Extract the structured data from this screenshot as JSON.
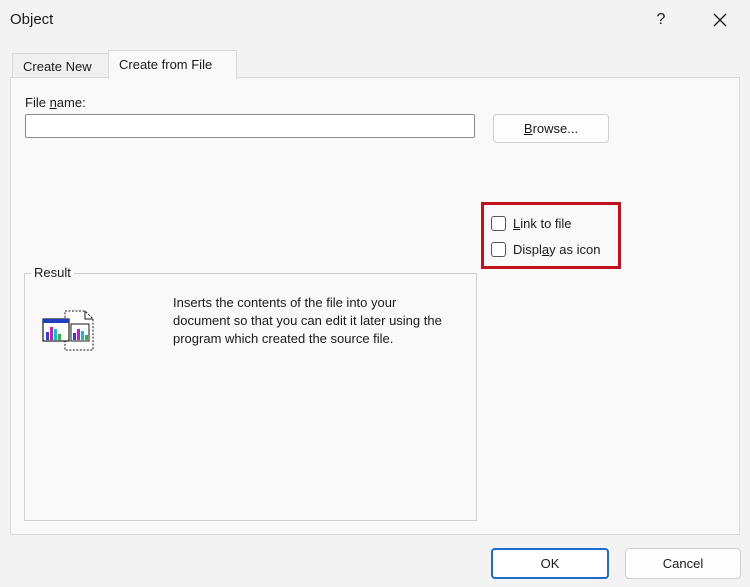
{
  "window": {
    "title": "Object",
    "help_label": "?"
  },
  "tabs": [
    {
      "label": "Create New",
      "active": false
    },
    {
      "label": "Create from File",
      "active": true
    }
  ],
  "file_name": {
    "label_pre": "File ",
    "label_mnemonic": "n",
    "label_post": "ame:",
    "value": "",
    "placeholder": ""
  },
  "browse": {
    "mnemonic": "B",
    "rest": "rowse..."
  },
  "options": {
    "link": {
      "mnemonic": "L",
      "rest": "ink to file",
      "checked": false
    },
    "icon": {
      "pre": "Displ",
      "mnemonic": "a",
      "post": "y as icon",
      "checked": false
    },
    "highlight_color": "#c0111f"
  },
  "result": {
    "label": "Result",
    "icon": "embedded-document-icon",
    "text": "Inserts the contents of the file into your\ndocument so that you can edit it later using the\nprogram which created the source file."
  },
  "buttons": {
    "ok": "OK",
    "cancel": "Cancel"
  },
  "colors": {
    "accent": "#1f6bcb"
  }
}
